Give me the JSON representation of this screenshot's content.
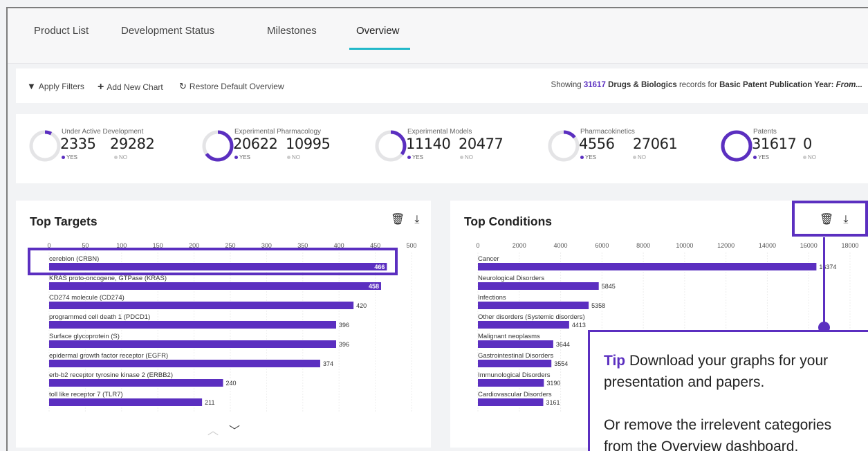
{
  "tabs": [
    {
      "label": "Product List"
    },
    {
      "label": "Development Status"
    },
    {
      "label": "Milestones"
    },
    {
      "label": "Overview"
    }
  ],
  "toolbar": {
    "apply_filters": "Apply Filters",
    "add_chart": "Add New Chart",
    "restore": "Restore Default Overview",
    "showing_prefix": "Showing",
    "showing_count": "31617",
    "showing_type": "Drugs & Biologics",
    "showing_mid": "records for",
    "showing_field": "Basic Patent Publication Year:",
    "showing_from": "From..."
  },
  "stats": [
    {
      "label": "Under Active Development",
      "yes": "2335",
      "no": "29282",
      "yes_label": "YES",
      "no_label": "NO",
      "fraction": 0.074
    },
    {
      "label": "Experimental Pharmacology",
      "yes": "20622",
      "no": "10995",
      "yes_label": "YES",
      "no_label": "NO",
      "fraction": 0.652
    },
    {
      "label": "Experimental Models",
      "yes": "11140",
      "no": "20477",
      "yes_label": "YES",
      "no_label": "NO",
      "fraction": 0.352
    },
    {
      "label": "Pharmacokinetics",
      "yes": "4556",
      "no": "27061",
      "yes_label": "YES",
      "no_label": "NO",
      "fraction": 0.144
    },
    {
      "label": "Patents",
      "yes": "31617",
      "no": "0",
      "yes_label": "YES",
      "no_label": "NO",
      "fraction": 1.0
    }
  ],
  "panels": {
    "left_title": "Top Targets",
    "right_title": "Top Conditions"
  },
  "colors": {
    "accent": "#5b2fc0",
    "tab_underline": "#22b8c9"
  },
  "icons": {
    "delete": "trash-icon",
    "download": "download-icon"
  },
  "chart_data": [
    {
      "type": "bar",
      "orientation": "horizontal",
      "title": "Top Targets",
      "xlim": [
        0,
        500
      ],
      "ticks": [
        0,
        50,
        100,
        150,
        200,
        250,
        300,
        350,
        400,
        450,
        500
      ],
      "categories": [
        "cereblon (CRBN)",
        "KRAS proto-oncogene, GTPase (KRAS)",
        "CD274 molecule (CD274)",
        "programmed cell death 1 (PDCD1)",
        "Surface glycoprotein (S)",
        "epidermal growth factor receptor (EGFR)",
        "erb-b2 receptor tyrosine kinase 2 (ERBB2)",
        "toll like receptor 7 (TLR7)"
      ],
      "values": [
        466,
        458,
        420,
        396,
        396,
        374,
        240,
        211
      ]
    },
    {
      "type": "bar",
      "orientation": "horizontal",
      "title": "Top Conditions",
      "xlim": [
        0,
        18000
      ],
      "ticks": [
        0,
        2000,
        4000,
        6000,
        8000,
        10000,
        12000,
        14000,
        16000,
        18000
      ],
      "categories": [
        "Cancer",
        "Neurological Disorders",
        "Infections",
        "Other disorders (Systemic disorders)",
        "Malignant neoplasms",
        "Gastrointestinal Disorders",
        "Immunological Disorders",
        "Cardiovascular Disorders"
      ],
      "values": [
        16374,
        5845,
        5358,
        4413,
        3644,
        3554,
        3190,
        3161
      ]
    }
  ],
  "tip": {
    "heading": "Tip",
    "line1": "Download your graphs for your",
    "line2": "presentation and papers.",
    "line3": "Or remove the irrelevent categories",
    "line4": "from the Overview dashboard."
  }
}
